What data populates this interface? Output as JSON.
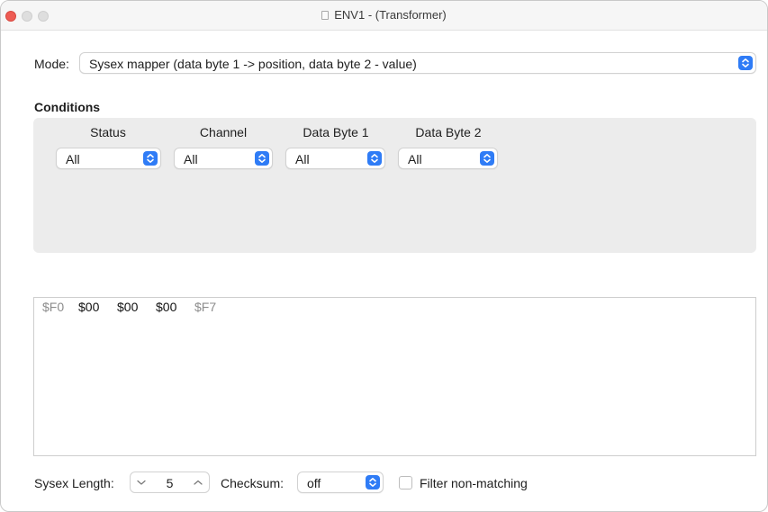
{
  "window": {
    "title": "ENV1 - (Transformer)"
  },
  "mode": {
    "label": "Mode:",
    "value": "Sysex mapper (data byte 1 -> position, data byte 2 - value)"
  },
  "conditions": {
    "heading": "Conditions",
    "columns": [
      {
        "header": "Status",
        "value": "All"
      },
      {
        "header": "Channel",
        "value": "All"
      },
      {
        "header": "Data Byte 1",
        "value": "All"
      },
      {
        "header": "Data Byte 2",
        "value": "All"
      }
    ]
  },
  "sysex": {
    "bytes": [
      {
        "text": "$F0",
        "style": "dim"
      },
      {
        "text": "$00",
        "style": "strong"
      },
      {
        "text": "$00",
        "style": "strong"
      },
      {
        "text": "$00",
        "style": "strong"
      },
      {
        "text": "$F7",
        "style": "dim"
      }
    ]
  },
  "footer": {
    "sysex_length_label": "Sysex Length:",
    "sysex_length_value": "5",
    "checksum_label": "Checksum:",
    "checksum_value": "off",
    "filter_label": "Filter non-matching",
    "filter_checked": false
  },
  "colors": {
    "accent": "#2f7cf6",
    "close_button": "#ee5c54",
    "panel": "#ececec"
  }
}
